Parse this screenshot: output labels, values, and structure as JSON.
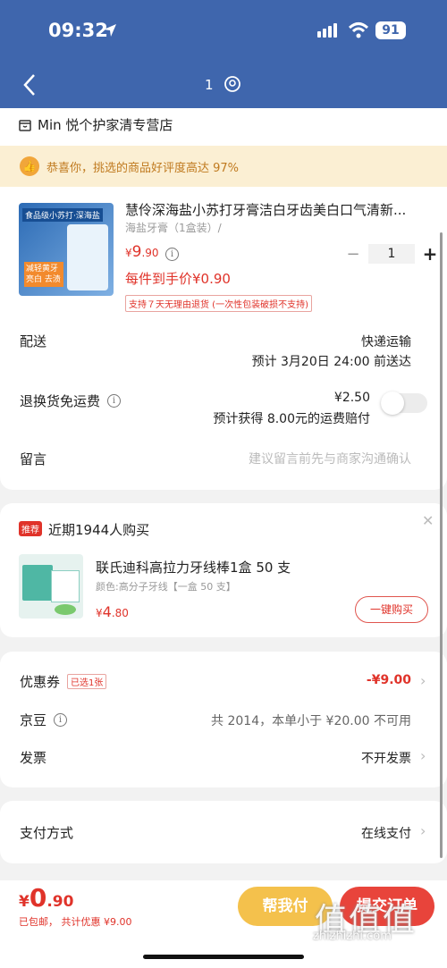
{
  "status": {
    "time": "09:32",
    "battery": "91"
  },
  "nav": {
    "count": "1"
  },
  "shop": {
    "name": "Min 悦个护家清专营店"
  },
  "banner": {
    "text": "恭喜你，挑选的商品好评度高达 97%"
  },
  "product": {
    "title": "慧伶深海盐小苏打牙膏洁白牙齿美白口气清新...",
    "spec": "海盐牙膏（1盒装）/",
    "price_symbol": "¥",
    "price_int": "9",
    "price_dec": ".90",
    "unit_price": "每件到手价¥0.90",
    "return_tag": "支持７天无理由退货 (一次性包装破损不支持)",
    "quantity": "1",
    "image_text_top": "食品级小苏打·深海盐",
    "image_text_tag": "减轻黄牙 亮白 去渍"
  },
  "delivery": {
    "label": "配送",
    "method": "快递运输",
    "eta": "预计 3月20日 24:00 前送达"
  },
  "return_shipping": {
    "label": "退换货免运费",
    "price": "¥2.50",
    "note": "预计获得 8.00元的运费赔付"
  },
  "message": {
    "label": "留言",
    "placeholder": "建议留言前先与商家沟通确认"
  },
  "recommend": {
    "tag": "推荐",
    "title": "近期1944人购买",
    "name": "联氏迪科高拉力牙线棒1盒 50 支",
    "spec": "颜色:高分子牙线【一盒 50 支】",
    "price_symbol": "¥",
    "price_int": "4",
    "price_dec": ".80",
    "buy_label": "一键购买"
  },
  "coupon": {
    "label": "优惠券",
    "selected": "已选1张",
    "value": "-¥9.00"
  },
  "jingdou": {
    "label": "京豆",
    "value": "共 2014，本单小于 ¥20.00 不可用"
  },
  "invoice": {
    "label": "发票",
    "value": "不开发票"
  },
  "payment": {
    "label": "支付方式",
    "value": "在线支付"
  },
  "bottom": {
    "total_symbol": "¥",
    "total_int": "0",
    "total_dec": ".90",
    "note": "已包邮，  共计优惠 ¥9.00",
    "help_pay": "帮我付",
    "submit": "提交订单"
  },
  "watermark": {
    "text": "zhizhizhi.com",
    "logo": "值值值"
  },
  "colors": {
    "header": "#3f66ad",
    "accent": "#e0332a",
    "yellow_button": "#f4c14c",
    "red_button": "#e8443b"
  }
}
